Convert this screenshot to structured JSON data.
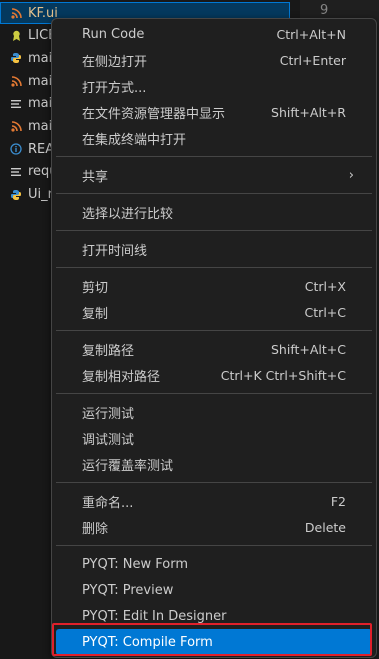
{
  "explorer": {
    "line_number": "9",
    "items": [
      {
        "label": "KF.ui",
        "icon": "rss-icon",
        "color": "#e37933"
      },
      {
        "label": "LICE",
        "icon": "license-icon",
        "color": "#cbcb41"
      },
      {
        "label": "mai",
        "icon": "python-icon",
        "color": "#3b8ed0"
      },
      {
        "label": "mai",
        "icon": "rss-icon",
        "color": "#e37933"
      },
      {
        "label": "mai",
        "icon": "lines-icon",
        "color": "#cccccc"
      },
      {
        "label": "mai",
        "icon": "rss-icon",
        "color": "#e37933"
      },
      {
        "label": "REA",
        "icon": "info-icon",
        "color": "#3b8ed0"
      },
      {
        "label": "requ",
        "icon": "lines-icon",
        "color": "#cccccc"
      },
      {
        "label": "Ui_r",
        "icon": "python-icon",
        "color": "#3b8ed0"
      }
    ]
  },
  "menu": {
    "groups": [
      [
        {
          "label": "Run Code",
          "shortcut": "Ctrl+Alt+N"
        },
        {
          "label": "在侧边打开",
          "shortcut": "Ctrl+Enter"
        },
        {
          "label": "打开方式...",
          "shortcut": ""
        },
        {
          "label": "在文件资源管理器中显示",
          "shortcut": "Shift+Alt+R"
        },
        {
          "label": "在集成终端中打开",
          "shortcut": ""
        }
      ],
      [
        {
          "label": "共享",
          "shortcut": "",
          "submenu": true
        }
      ],
      [
        {
          "label": "选择以进行比较",
          "shortcut": ""
        }
      ],
      [
        {
          "label": "打开时间线",
          "shortcut": ""
        }
      ],
      [
        {
          "label": "剪切",
          "shortcut": "Ctrl+X"
        },
        {
          "label": "复制",
          "shortcut": "Ctrl+C"
        }
      ],
      [
        {
          "label": "复制路径",
          "shortcut": "Shift+Alt+C"
        },
        {
          "label": "复制相对路径",
          "shortcut": "Ctrl+K Ctrl+Shift+C"
        }
      ],
      [
        {
          "label": "运行测试",
          "shortcut": ""
        },
        {
          "label": "调试测试",
          "shortcut": ""
        },
        {
          "label": "运行覆盖率测试",
          "shortcut": ""
        }
      ],
      [
        {
          "label": "重命名...",
          "shortcut": "F2"
        },
        {
          "label": "删除",
          "shortcut": "Delete"
        }
      ],
      [
        {
          "label": "PYQT: New Form",
          "shortcut": ""
        },
        {
          "label": "PYQT: Preview",
          "shortcut": ""
        },
        {
          "label": "PYQT: Edit In Designer",
          "shortcut": ""
        },
        {
          "label": "PYQT: Compile Form",
          "shortcut": "",
          "active": true
        }
      ]
    ],
    "submenu_glyph": "›"
  },
  "colors": {
    "accent": "#0078d4",
    "highlight_box": "#e0202a",
    "background": "#1f1f1f"
  }
}
